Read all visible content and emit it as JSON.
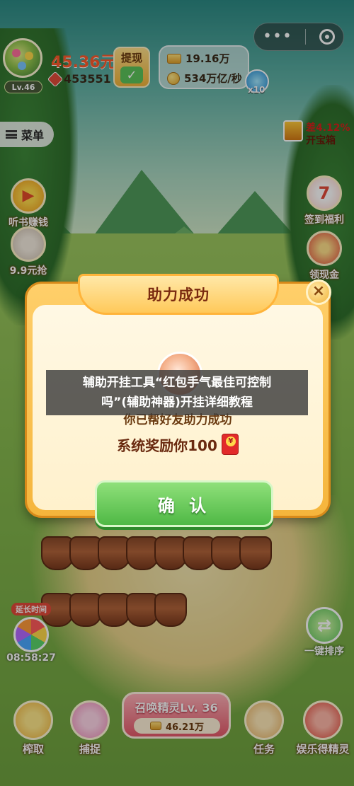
{
  "hud": {
    "money": "45.36元",
    "withdraw_label": "提现",
    "level": "Lv.46",
    "gems": "453551",
    "coins_total": "19.16万",
    "coins_rate": "534万亿/秒",
    "multiplier": "x10"
  },
  "left_menu": {
    "menu_label": "菜单",
    "listen_label": "听书赚钱",
    "grab_label": "9.9元抢"
  },
  "right_menu": {
    "treasure_line1": "差4.12%",
    "treasure_line2": "开宝箱",
    "sign_label": "签到福利",
    "cash_label": "领现金"
  },
  "dialog": {
    "title": "助力成功",
    "close": "×",
    "helper_text": "你已帮好友助力成功",
    "reward_text": "系统奖励你100",
    "confirm": "确 认"
  },
  "caption": {
    "line1": "辅助开挂工具“红包手气最佳可控制",
    "line2": "吗”(辅助神器)开挂详细教程"
  },
  "gameplay": {
    "timer_tag": "延长时间",
    "timer": "08:58:27",
    "sort_label": "一键排序"
  },
  "bottom": {
    "grab": "榨取",
    "catch": "捕捉",
    "summon_title": "召唤精灵Lv. 36",
    "summon_cost": "46.21万",
    "task": "任务",
    "fun": "娱乐得精灵"
  },
  "colors": {
    "dialog_gold": "#f5b53c",
    "confirm_green": "#4fb845",
    "money_red": "#ff5a2b"
  }
}
